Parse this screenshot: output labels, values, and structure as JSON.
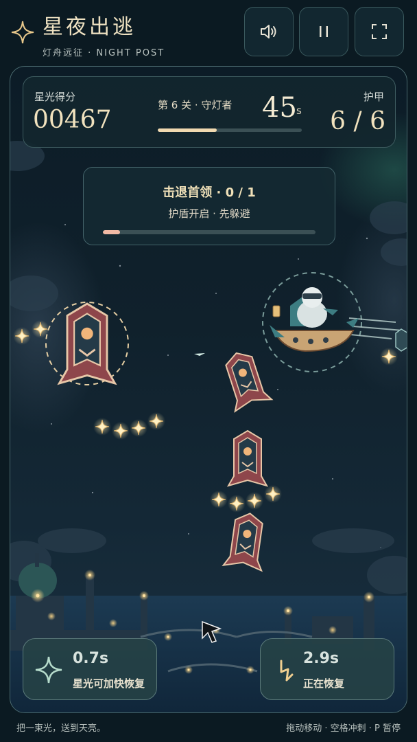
{
  "header": {
    "title": "星夜出逃",
    "subtitle": "灯舟远征 · NIGHT POST",
    "buttons": [
      {
        "icon": "speaker-icon",
        "label": "sound"
      },
      {
        "icon": "pause-icon",
        "label": "pause"
      },
      {
        "icon": "fullscreen-icon",
        "label": "fullscreen"
      }
    ]
  },
  "hud": {
    "score_label": "星光得分",
    "score_value": "00467",
    "level_label": "第 6 关 · 守灯者",
    "timer_value": "45",
    "timer_unit": "s",
    "level_progress": 0.41,
    "armor_label": "护甲",
    "armor_value": "6 / 6"
  },
  "objective": {
    "title": "击退首领 · 0 / 1",
    "subtitle": "护盾开启 · 先躲避",
    "progress": 0.08
  },
  "skills": [
    {
      "value": "0.7s",
      "label": "星光可加快恢复",
      "icon": "sparkle-icon"
    },
    {
      "value": "2.9s",
      "label": "正在恢复",
      "icon": "lightning-icon"
    }
  ],
  "footer": {
    "left": "把一束光，送到天亮。",
    "right": "拖动移动 · 空格冲刺 · P 暂停"
  },
  "colors": {
    "accent_gold": "#f0d9b0",
    "enemy_red": "#9a4a4e",
    "panel_bg": "#12262e",
    "boss_progress": "#f1b9a4"
  }
}
